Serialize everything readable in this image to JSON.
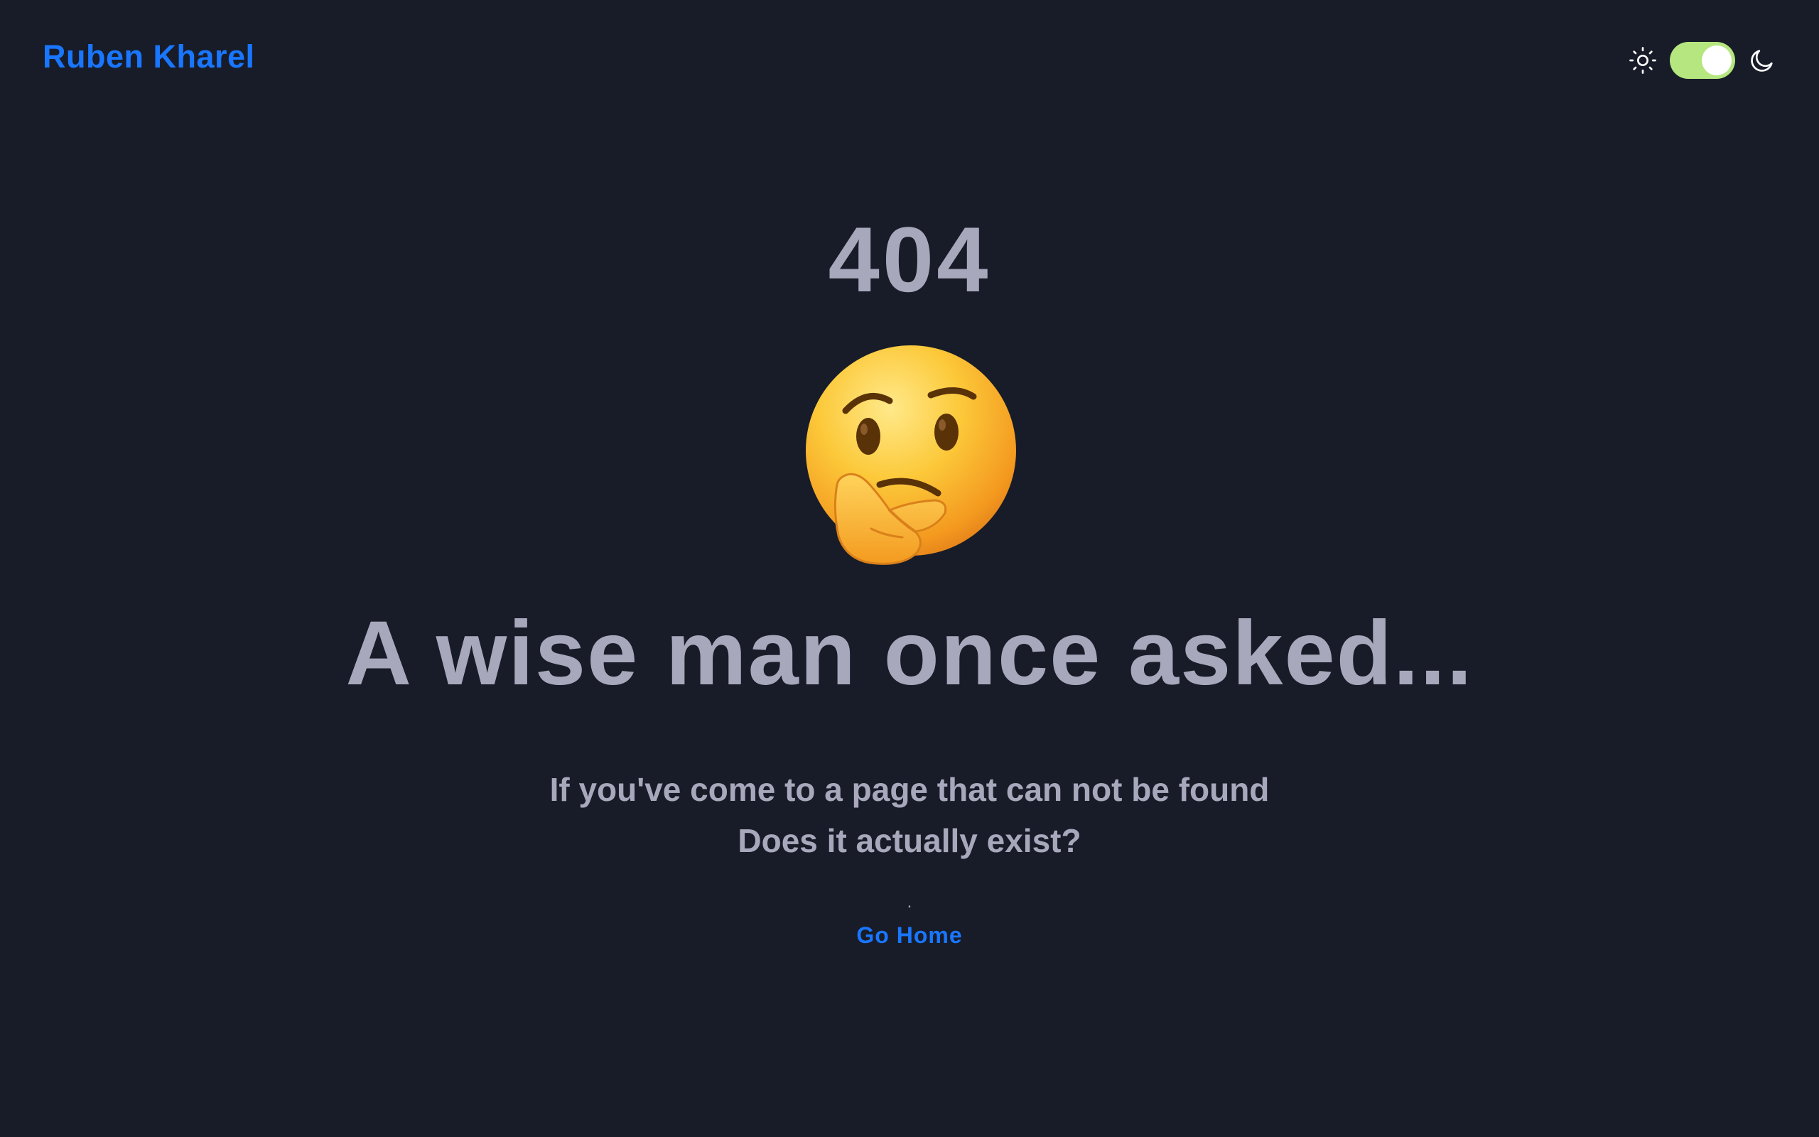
{
  "header": {
    "brand": "Ruben Kharel",
    "theme_toggle": {
      "light_icon": "sun-icon",
      "dark_icon": "moon-icon",
      "state": "dark",
      "track_color": "#b5e67f"
    }
  },
  "main": {
    "error_code": "404",
    "emoji": "thinking-face-icon",
    "headline": "A wise man once asked...",
    "lines": [
      "If you've come to a page that can not be found",
      "Does it actually exist?"
    ],
    "separator": ".",
    "home_link": "Go Home"
  },
  "colors": {
    "background": "#181c28",
    "accent": "#1976ff",
    "text": "#a8a8bc"
  }
}
